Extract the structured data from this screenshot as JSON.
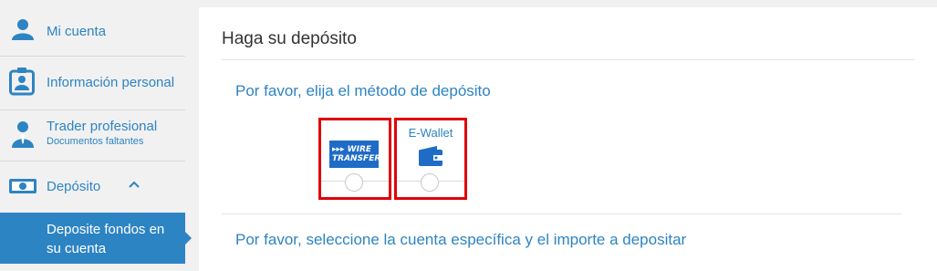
{
  "sidebar": {
    "items": [
      {
        "label": "Mi cuenta",
        "icon": "user-icon"
      },
      {
        "label": "Información personal",
        "icon": "id-badge-icon"
      },
      {
        "label": "Trader profesional",
        "sub": "Documentos faltantes",
        "icon": "trader-icon"
      },
      {
        "label": "Depósito",
        "icon": "cash-icon",
        "toggle": "chevron-up-icon"
      }
    ],
    "active_item": {
      "line1": "Deposite fondos en",
      "line2": "su cuenta"
    }
  },
  "main": {
    "title": "Haga su depósito",
    "choose_method": "Por favor, elija el método de depósito",
    "methods": [
      {
        "name": "wire-transfer",
        "logo_line1": "▸▸▸ WIRE",
        "logo_line2": "TRANSFER",
        "selected": false
      },
      {
        "name": "e-wallet",
        "label": "E-Wallet",
        "icon": "wallet-icon",
        "selected": false
      }
    ],
    "select_account": "Por favor, seleccione la cuenta específica y el importe a depositar"
  },
  "colors": {
    "accent": "#2d84c3",
    "highlight_border": "#e0000a",
    "wire_blue": "#1f6cc7"
  }
}
